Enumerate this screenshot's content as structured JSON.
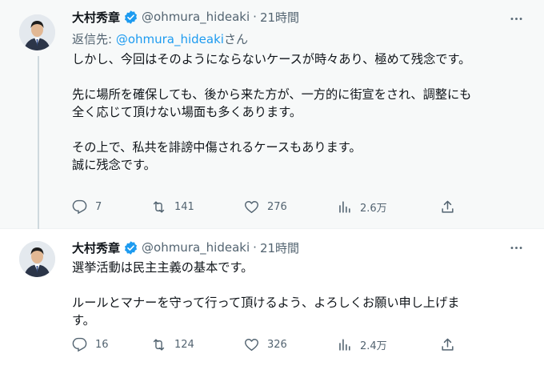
{
  "tweets": [
    {
      "author": {
        "name": "大村秀章",
        "handle": "@ohmura_hideaki",
        "time": "21時間",
        "verified_icon": "verified-badge-icon"
      },
      "reply_to": {
        "prefix": "返信先: ",
        "mention": "@ohmura_hideaki",
        "suffix": "さん"
      },
      "paragraphs": [
        [
          "しかし、今回はそのようにならないケースが時々あり、極めて残念です。"
        ],
        [
          "先に場所を確保しても、後から来た方が、一方的に街宣をされ、調整にも",
          "全く応じて頂けない場面も多くあります。"
        ],
        [
          "その上で、私共を誹謗中傷されるケースもあります。",
          "誠に残念です。"
        ]
      ],
      "stats": {
        "replies": "7",
        "retweets": "141",
        "likes": "276",
        "views": "2.6万"
      }
    },
    {
      "author": {
        "name": "大村秀章",
        "handle": "@ohmura_hideaki",
        "time": "21時間",
        "verified_icon": "verified-badge-icon"
      },
      "paragraphs": [
        [
          "選挙活動は民主主義の基本です。"
        ],
        [
          "ルールとマナーを守って行って頂けるよう、よろしくお願い申し上げま",
          "す。"
        ]
      ],
      "stats": {
        "replies": "16",
        "retweets": "124",
        "likes": "326",
        "views": "2.4万"
      }
    }
  ],
  "ui": {
    "separator": "·",
    "more_icon": "more-horizontal-icon",
    "accent": "#1d9bf0",
    "muted": "#536471"
  }
}
